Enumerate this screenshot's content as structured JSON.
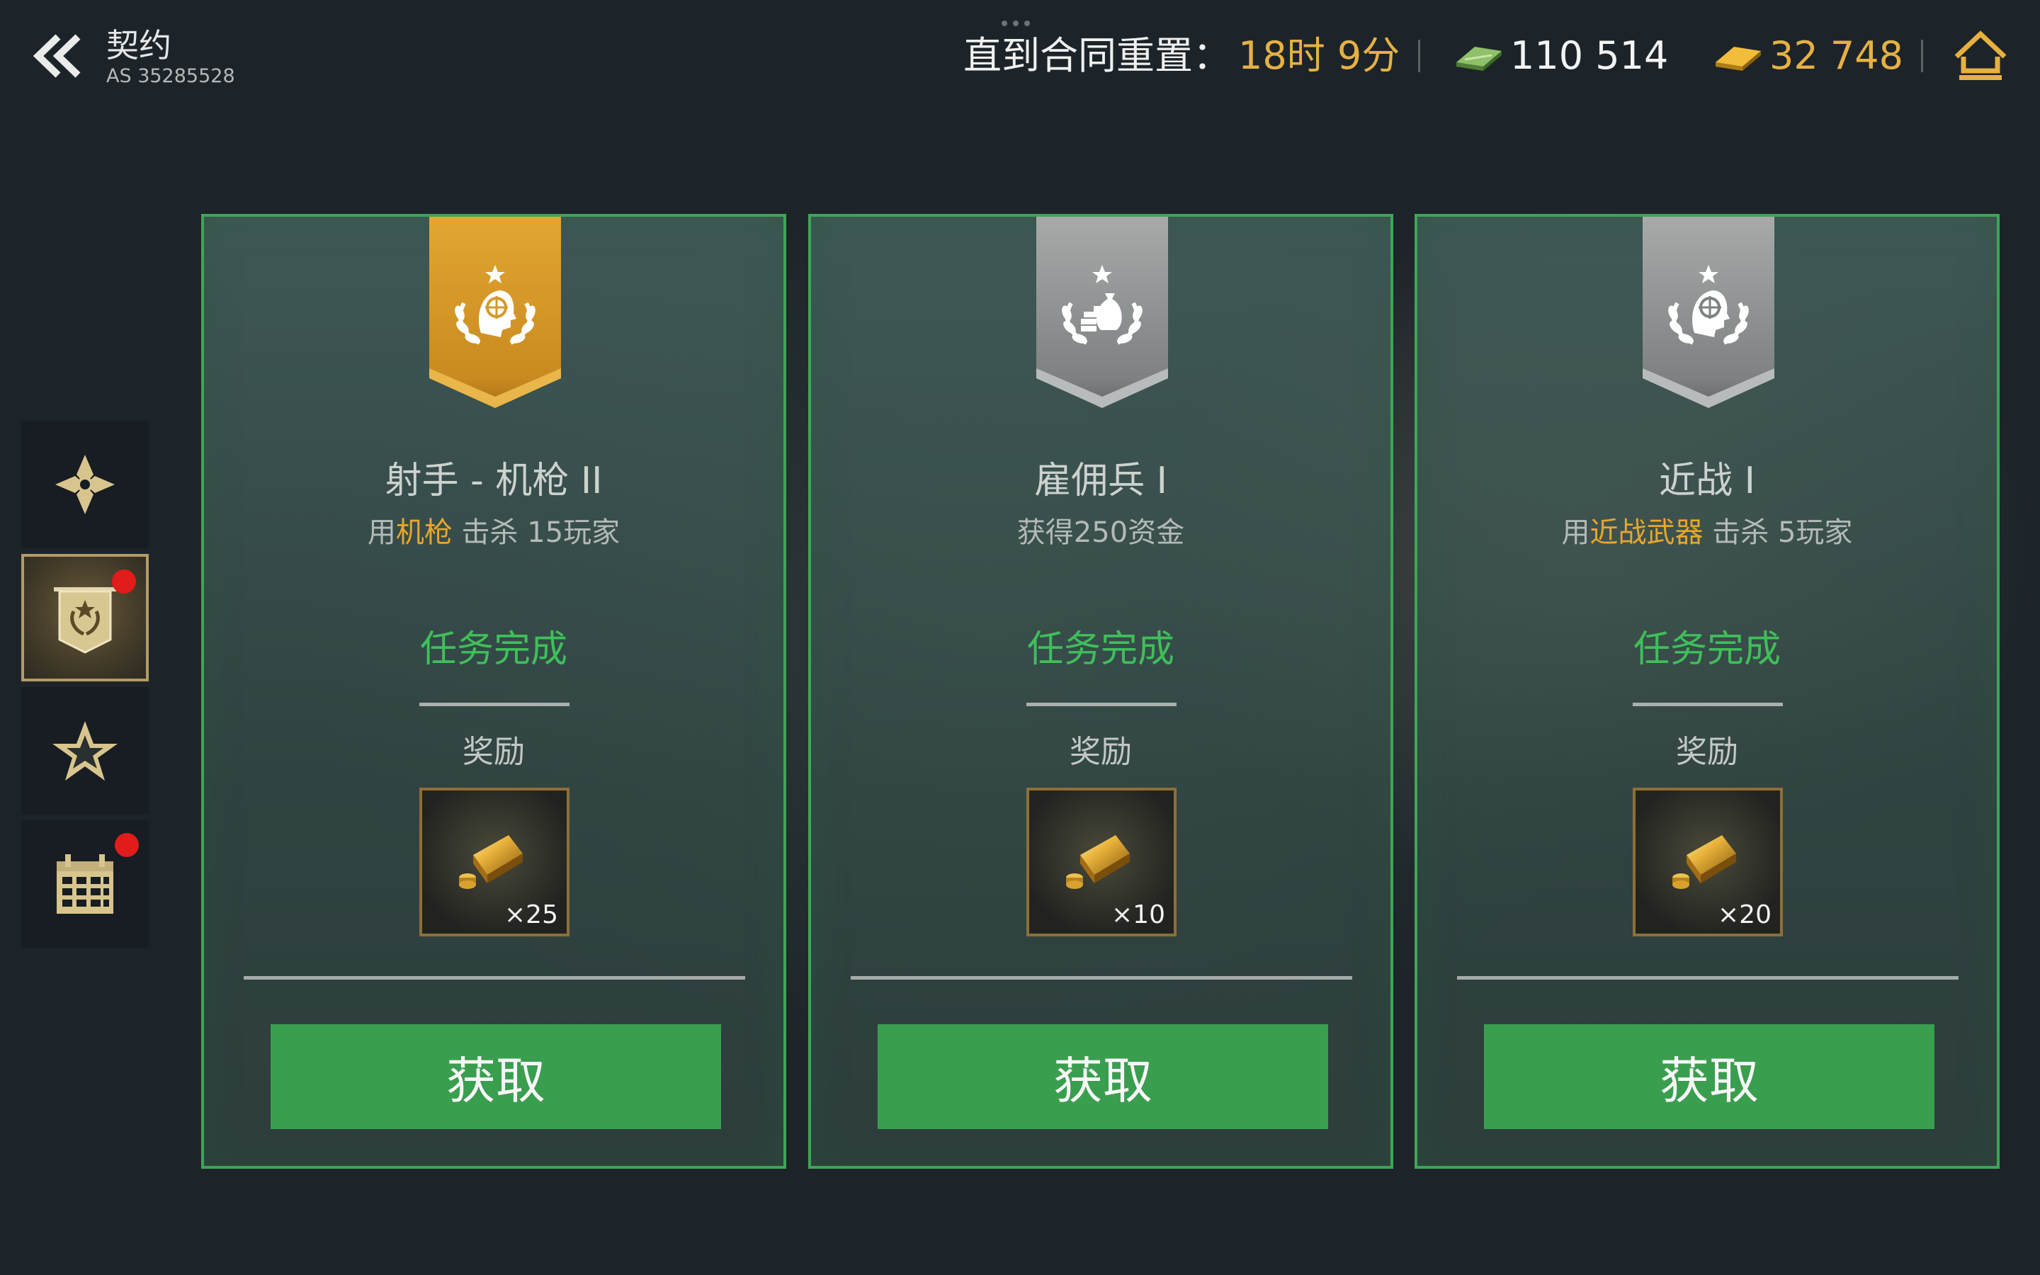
{
  "header": {
    "title": "契约",
    "subtitle": "AS 35285528",
    "reset_label": "直到合同重置：",
    "reset_time": "18时 9分",
    "cash": "110 514",
    "gold": "32 748",
    "colors": {
      "accent_gold": "#e6b143",
      "text": "#f0f0f0"
    }
  },
  "sidebar": {
    "tabs": [
      {
        "icon": "emblem-icon",
        "active": false,
        "notification": false
      },
      {
        "icon": "contracts-badge-icon",
        "active": true,
        "notification": true
      },
      {
        "icon": "star-icon",
        "active": false,
        "notification": false
      },
      {
        "icon": "calendar-icon",
        "active": false,
        "notification": true
      }
    ]
  },
  "cards": [
    {
      "ribbon": "gold",
      "emblem": "marksman-icon",
      "title": "射手 - 机枪 II",
      "desc_pre": "用",
      "desc_highlight": "机枪",
      "desc_post": " 击杀 15玩家",
      "status": "任务完成",
      "reward_label": "奖励",
      "reward_qty": "×25",
      "button": "获取"
    },
    {
      "ribbon": "silver",
      "emblem": "money-bag-icon",
      "title": "雇佣兵 I",
      "desc_pre": "获得250资金",
      "desc_highlight": "",
      "desc_post": "",
      "status": "任务完成",
      "reward_label": "奖励",
      "reward_qty": "×10",
      "button": "获取"
    },
    {
      "ribbon": "silver",
      "emblem": "melee-icon",
      "title": "近战 I",
      "desc_pre": "用",
      "desc_highlight": "近战武器",
      "desc_post": " 击杀 5玩家",
      "status": "任务完成",
      "reward_label": "奖励",
      "reward_qty": "×20",
      "button": "获取"
    }
  ],
  "colors": {
    "card_border": "#3fa556",
    "status_green": "#3fbf5a",
    "button_green": "#3a9e4f",
    "highlight_orange": "#e6a72d",
    "notification_red": "#e21b1b"
  }
}
